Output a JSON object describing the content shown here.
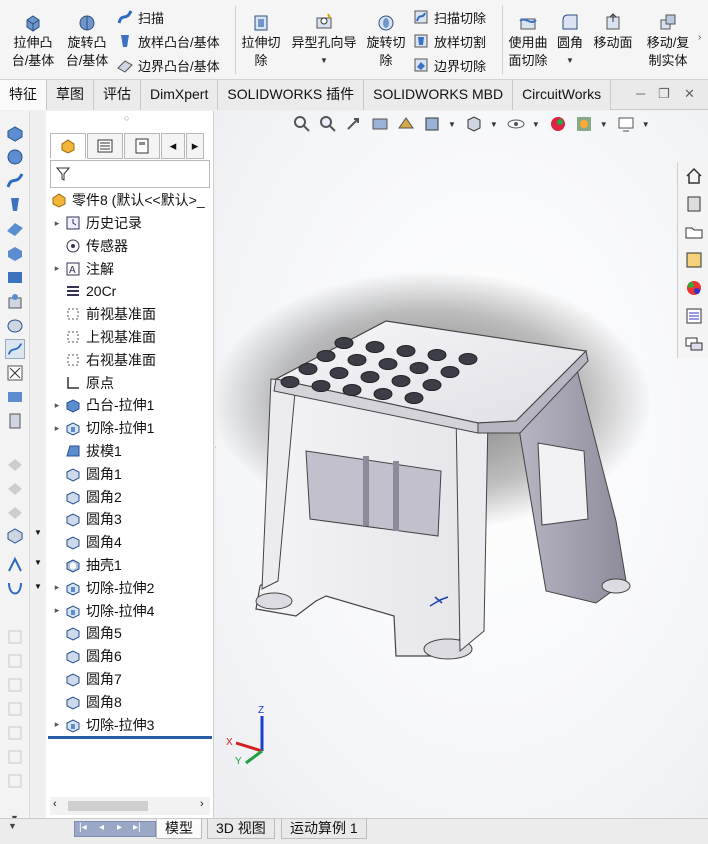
{
  "ribbon": {
    "extrude_boss": "拉伸凸\n台/基体",
    "revolve_boss": "旋转凸\n台/基体",
    "sweep": "扫描",
    "loft_boss": "放样凸台/基体",
    "boundary_boss": "边界凸台/基体",
    "extrude_cut": "拉伸切\n除",
    "hole_wizard": "异型孔向导",
    "revolve_cut": "旋转切\n除",
    "swept_cut": "扫描切除",
    "lofted_cut": "放样切割",
    "boundary_cut": "边界切除",
    "surface_cut": "使用曲\n面切除",
    "fillet": "圆角",
    "move_face": "移动面",
    "move_copy_body": "移动/复\n制实体"
  },
  "tabs": [
    "特征",
    "草图",
    "评估",
    "DimXpert",
    "SOLIDWORKS 插件",
    "SOLIDWORKS MBD",
    "CircuitWorks"
  ],
  "active_tab": 0,
  "tree": {
    "root": "零件8 (默认<<默认>_",
    "items": [
      {
        "label": "历史记录",
        "icon": "history-icon",
        "expand": true
      },
      {
        "label": "传感器",
        "icon": "sensor-icon",
        "expand": false
      },
      {
        "label": "注解",
        "icon": "annotation-icon",
        "expand": true
      },
      {
        "label": "20Cr",
        "icon": "material-icon",
        "expand": false
      },
      {
        "label": "前视基准面",
        "icon": "plane-icon",
        "expand": false
      },
      {
        "label": "上视基准面",
        "icon": "plane-icon",
        "expand": false
      },
      {
        "label": "右视基准面",
        "icon": "plane-icon",
        "expand": false
      },
      {
        "label": "原点",
        "icon": "origin-icon",
        "expand": false
      },
      {
        "label": "凸台-拉伸1",
        "icon": "extrude-icon",
        "expand": true
      },
      {
        "label": "切除-拉伸1",
        "icon": "cut-extrude-icon",
        "expand": true
      },
      {
        "label": "拔模1",
        "icon": "draft-icon",
        "expand": false
      },
      {
        "label": "圆角1",
        "icon": "fillet-icon",
        "expand": false
      },
      {
        "label": "圆角2",
        "icon": "fillet-icon",
        "expand": false
      },
      {
        "label": "圆角3",
        "icon": "fillet-icon",
        "expand": false
      },
      {
        "label": "圆角4",
        "icon": "fillet-icon",
        "expand": false
      },
      {
        "label": "抽壳1",
        "icon": "shell-icon",
        "expand": false
      },
      {
        "label": "切除-拉伸2",
        "icon": "cut-extrude-icon",
        "expand": true
      },
      {
        "label": "切除-拉伸4",
        "icon": "cut-extrude-icon",
        "expand": true
      },
      {
        "label": "圆角5",
        "icon": "fillet-icon",
        "expand": false
      },
      {
        "label": "圆角6",
        "icon": "fillet-icon",
        "expand": false
      },
      {
        "label": "圆角7",
        "icon": "fillet-icon",
        "expand": false
      },
      {
        "label": "圆角8",
        "icon": "fillet-icon",
        "expand": false
      },
      {
        "label": "切除-拉伸3",
        "icon": "cut-extrude-icon",
        "expand": true
      }
    ]
  },
  "triad": {
    "x": "X",
    "y": "Y",
    "z": "Z"
  },
  "bottom_tabs": [
    "模型",
    "3D 视图",
    "运动算例 1"
  ],
  "colors": {
    "accent": "#2a5da8",
    "stool_face": "#f4f4f6",
    "stool_shade": "#8a8796",
    "hole_dark": "#3d3d48"
  }
}
